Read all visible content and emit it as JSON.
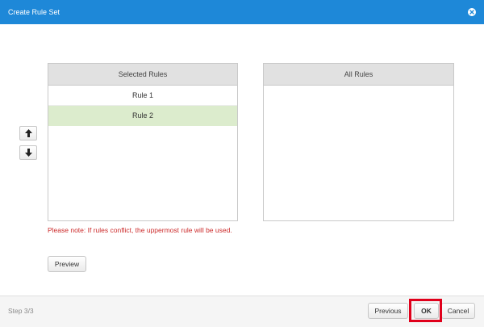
{
  "dialog": {
    "title": "Create Rule Set",
    "close_icon": "close-circle-icon"
  },
  "selected_rules": {
    "header": "Selected Rules",
    "items": [
      {
        "label": "Rule 1",
        "selected": false
      },
      {
        "label": "Rule 2",
        "selected": true
      }
    ]
  },
  "all_rules": {
    "header": "All Rules",
    "items": []
  },
  "order_controls": {
    "move_up_icon": "arrow-up-icon",
    "move_down_icon": "arrow-down-icon"
  },
  "note": "Please note: If rules conflict, the uppermost rule will be used.",
  "preview_label": "Preview",
  "footer": {
    "step": "Step 3/3",
    "previous_label": "Previous",
    "ok_label": "OK",
    "cancel_label": "Cancel"
  },
  "colors": {
    "titlebar": "#1e88d8",
    "selected_row": "#dceccd",
    "note_text": "#cc2b2b",
    "highlight": "#e0001b"
  }
}
